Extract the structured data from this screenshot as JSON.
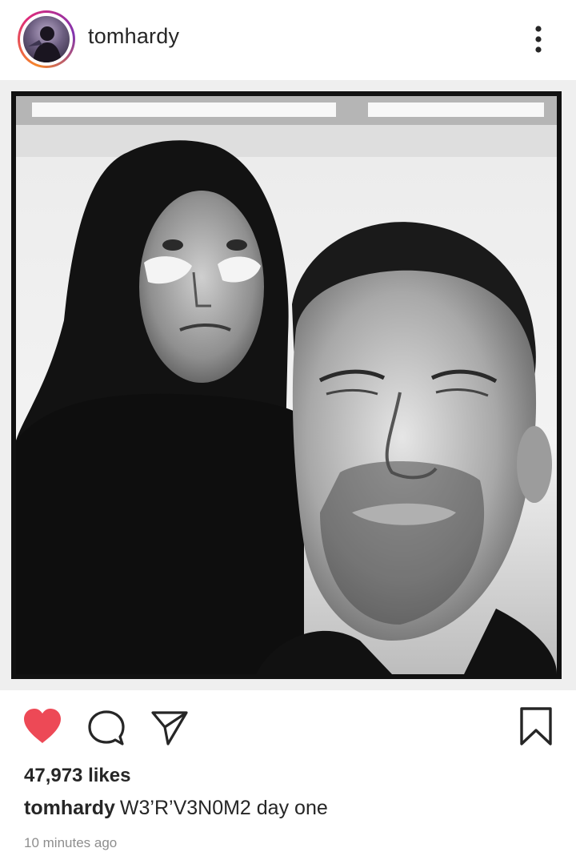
{
  "post": {
    "username": "tomhardy",
    "photo_description": "Black and white selfie photo",
    "likes": "47,973 likes",
    "caption_user": "tomhardy",
    "caption_text": "W3’R’V3N0M2 day one",
    "timestamp": "10 minutes ago"
  },
  "icons": {
    "more": "more-vertical-icon",
    "like": "heart-icon",
    "comment": "comment-icon",
    "share": "share-icon",
    "save": "bookmark-icon"
  },
  "colors": {
    "like_red": "#ed4956",
    "text": "#262626",
    "muted": "#8e8e8e"
  }
}
